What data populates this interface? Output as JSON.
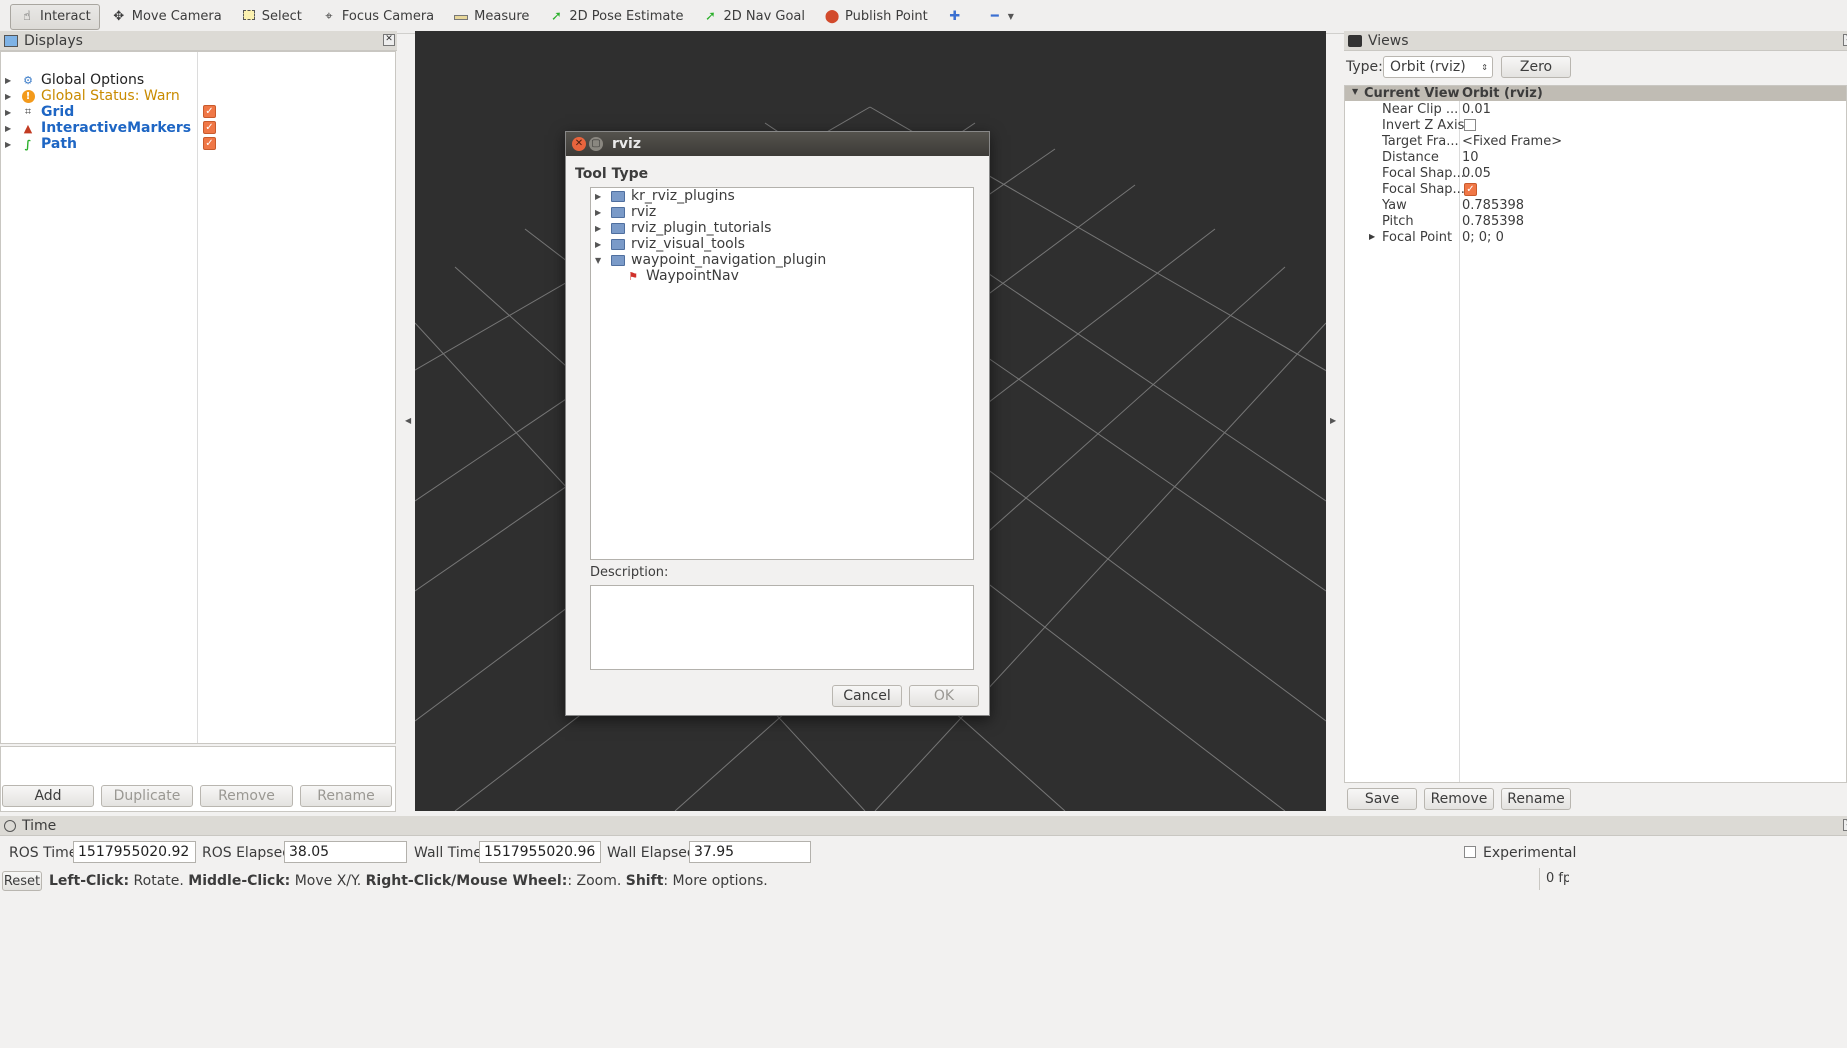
{
  "toolbar": {
    "interact": "Interact",
    "move_camera": "Move Camera",
    "select": "Select",
    "focus_camera": "Focus Camera",
    "measure": "Measure",
    "pose_estimate": "2D Pose Estimate",
    "nav_goal": "2D Nav Goal",
    "publish_point": "Publish Point"
  },
  "displays": {
    "title": "Displays",
    "items": [
      {
        "label": "Global Options",
        "color": "#222222"
      },
      {
        "label": "Global Status: Warn",
        "color": "#c98b00"
      },
      {
        "label": "Grid",
        "color": "#1e66c4"
      },
      {
        "label": "InteractiveMarkers",
        "color": "#1e66c4"
      },
      {
        "label": "Path",
        "color": "#1e66c4"
      }
    ],
    "buttons": {
      "add": "Add",
      "duplicate": "Duplicate",
      "remove": "Remove",
      "rename": "Rename"
    }
  },
  "dialog": {
    "title": "rviz",
    "tool_type_label": "Tool Type",
    "tree": [
      "kr_rviz_plugins",
      "rviz",
      "rviz_plugin_tutorials",
      "rviz_visual_tools",
      "waypoint_navigation_plugin"
    ],
    "child": "WaypointNav",
    "description_label": "Description:",
    "cancel": "Cancel",
    "ok": "OK"
  },
  "views": {
    "title": "Views",
    "type_label": "Type:",
    "type_value": "Orbit (rviz)",
    "zero": "Zero",
    "header_key": "Current View",
    "header_value": "Orbit (rviz)",
    "props": [
      {
        "k": "Near Clip ...",
        "v": "0.01"
      },
      {
        "k": "Invert Z Axis",
        "v": ""
      },
      {
        "k": "Target Fra...",
        "v": "<Fixed Frame>"
      },
      {
        "k": "Distance",
        "v": "10"
      },
      {
        "k": "Focal Shap...",
        "v": "0.05"
      },
      {
        "k": "Focal Shap...",
        "v": ""
      },
      {
        "k": "Yaw",
        "v": "0.785398"
      },
      {
        "k": "Pitch",
        "v": "0.785398"
      },
      {
        "k": "Focal Point",
        "v": "0; 0; 0"
      }
    ],
    "buttons": {
      "save": "Save",
      "remove": "Remove",
      "rename": "Rename"
    }
  },
  "time": {
    "title": "Time",
    "ros_time_label": "ROS Time:",
    "ros_time": "1517955020.92",
    "ros_elapsed_label": "ROS Elapsed:",
    "ros_elapsed": "38.05",
    "wall_time_label": "Wall Time:",
    "wall_time": "1517955020.96",
    "wall_elapsed_label": "Wall Elapsed:",
    "wall_elapsed": "37.95",
    "experimental": "Experimental"
  },
  "status": {
    "reset": "Reset",
    "left_click": "Left-Click:",
    "left_desc": " Rotate. ",
    "middle_click": "Middle-Click:",
    "middle_desc": " Move X/Y. ",
    "right_click": "Right-Click/Mouse Wheel:",
    "right_desc": ": Zoom. ",
    "shift": "Shift",
    "shift_desc": ": More options.",
    "fps": "0 fp"
  }
}
